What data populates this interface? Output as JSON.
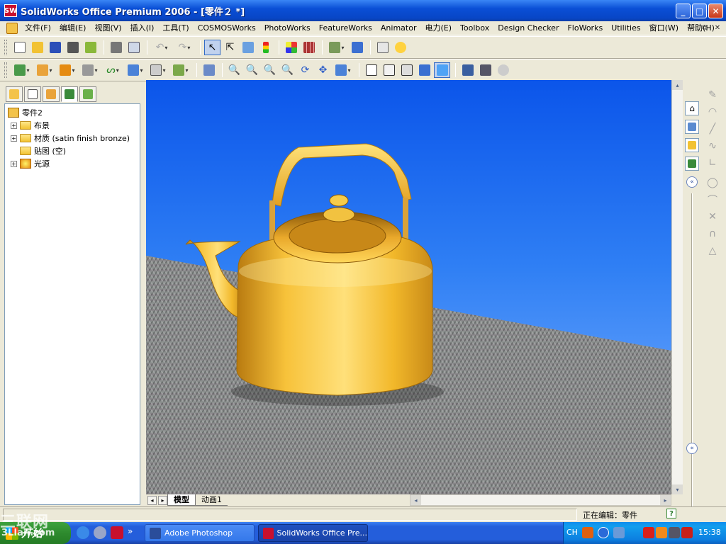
{
  "window": {
    "title": "SolidWorks Office Premium 2006 - [零件２ *]",
    "app_icon": "SW",
    "min": "_",
    "max": "□",
    "close": "✕"
  },
  "menu": {
    "items": [
      "文件(F)",
      "编辑(E)",
      "视图(V)",
      "插入(I)",
      "工具(T)",
      "COSMOSWorks",
      "PhotoWorks",
      "FeatureWorks",
      "Animator",
      "电力(E)",
      "Toolbox",
      "Design Checker",
      "FloWorks",
      "Utilities",
      "窗口(W)",
      "帮助(H)"
    ],
    "doc_min": "–",
    "doc_restore": "⧉",
    "doc_close": "✕"
  },
  "feature_tree": {
    "root": "零件2",
    "items": [
      {
        "label": "布景",
        "expander": "+",
        "icon": "folder-icon"
      },
      {
        "label": "材质 (satin finish bronze)",
        "expander": "+",
        "icon": "folder-icon"
      },
      {
        "label": "贴图 (空)",
        "expander": "",
        "icon": "folder-icon"
      },
      {
        "label": "光源",
        "expander": "+",
        "icon": "light-icon"
      }
    ]
  },
  "view_tabs": {
    "model": "模型",
    "animation": "动画1"
  },
  "scroll": {
    "left": "◂",
    "right": "▸",
    "up": "▴",
    "down": "▾",
    "nav_first": "◂",
    "nav_prev": "▸"
  },
  "task_pane": {
    "collapse_top": "«",
    "collapse_bottom": "«"
  },
  "status": {
    "text": "正在编辑：零件",
    "help": "?"
  },
  "taskbar": {
    "start_label": "开始",
    "quick_more": "»",
    "buttons": [
      {
        "label": "Adobe Photoshop"
      },
      {
        "label": "SolidWorks Office Pre..."
      }
    ],
    "lang": "CH",
    "clock": "15:38"
  },
  "watermark": {
    "line1": "三联网",
    "line2": "3LIan.com"
  },
  "colors": {
    "title_bar": "#0a4fd6",
    "sky_top": "#0b55ea",
    "kettle_gold": "#f5b82a",
    "taskbar": "#245edb"
  }
}
